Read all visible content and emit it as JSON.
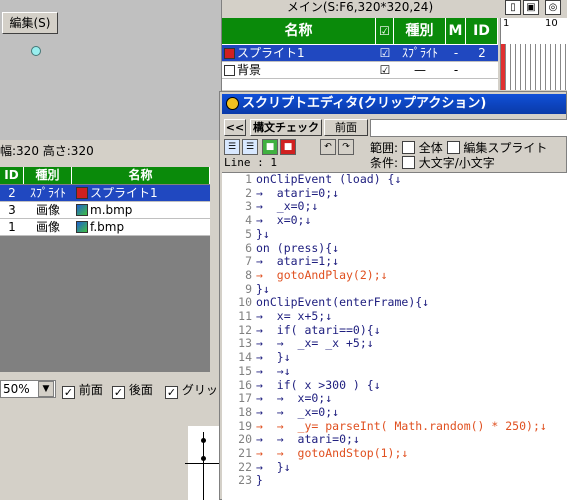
{
  "stage": {
    "edit_button": "編集(S)"
  },
  "size_text": "幅:320 高さ:320",
  "object_list": {
    "headers": [
      "ID",
      "種別",
      "名称"
    ],
    "rows": [
      {
        "id": "2",
        "type": "ｽﾌﾟﾗｲﾄ",
        "name": "スプライト1",
        "selected": true,
        "color": "#d02020"
      },
      {
        "id": "3",
        "type": "画像",
        "name": "m.bmp",
        "selected": false,
        "color": "#2060d0"
      },
      {
        "id": "1",
        "type": "画像",
        "name": "f.bmp",
        "selected": false,
        "color": "#2060d0"
      }
    ]
  },
  "toolbar": {
    "zoom": "50%",
    "front_label": "前面",
    "back_label": "後面",
    "grid_label": "グリッド"
  },
  "main_title": "メイン(S:F6,320*320,24)",
  "layer_table": {
    "headers": [
      "名称",
      "☑",
      "種別",
      "M",
      "ID"
    ],
    "rows": [
      {
        "name": "スプライト1",
        "checked": "☑",
        "type": "ｽﾌﾟﾗｲﾄ",
        "m": "-",
        "id": "2",
        "selected": true
      },
      {
        "name": "背景",
        "checked": "☑",
        "type": "—",
        "m": "-",
        "id": "",
        "selected": false
      }
    ]
  },
  "timeline": {
    "start": "1",
    "end": "10"
  },
  "editor": {
    "title": "スクリプトエディタ(クリップアクション)",
    "back_btn": "<<",
    "syntax_btn": "構文チェック",
    "front_btn": "前面",
    "range_label": "範囲:",
    "range_all": "全体",
    "range_edit": "編集スプライト",
    "cond_label": "条件:",
    "cond_case": "大文字/小文字",
    "line_indicator": "Line : 1",
    "code_lines": [
      {
        "n": "1",
        "t": "onClipEvent (load) {↓"
      },
      {
        "n": "2",
        "t": "→  atari=0;↓"
      },
      {
        "n": "3",
        "t": "→  _x=0;↓"
      },
      {
        "n": "4",
        "t": "→  x=0;↓"
      },
      {
        "n": "5",
        "t": "}↓"
      },
      {
        "n": "6",
        "t": "on (press){↓"
      },
      {
        "n": "7",
        "t": "→  atari=1;↓"
      },
      {
        "n": "8",
        "t": "→  gotoAndPlay(2);↓"
      },
      {
        "n": "9",
        "t": "}↓"
      },
      {
        "n": "10",
        "t": "onClipEvent(enterFrame){↓"
      },
      {
        "n": "11",
        "t": "→  x= x+5;↓"
      },
      {
        "n": "12",
        "t": "→  if( atari==0){↓"
      },
      {
        "n": "13",
        "t": "→  →  _x= _x +5;↓"
      },
      {
        "n": "14",
        "t": "→  }↓"
      },
      {
        "n": "15",
        "t": "→  →↓"
      },
      {
        "n": "16",
        "t": "→  if( x >300 ) {↓"
      },
      {
        "n": "17",
        "t": "→  →  x=0;↓"
      },
      {
        "n": "18",
        "t": "→  →  _x=0;↓"
      },
      {
        "n": "19",
        "t": "→  →  _y= parseInt( Math.random() * 250);↓"
      },
      {
        "n": "20",
        "t": "→  →  atari=0;↓"
      },
      {
        "n": "21",
        "t": "→  →  gotoAndStop(1);↓"
      },
      {
        "n": "22",
        "t": "→  }↓"
      },
      {
        "n": "23",
        "t": "}"
      }
    ]
  }
}
